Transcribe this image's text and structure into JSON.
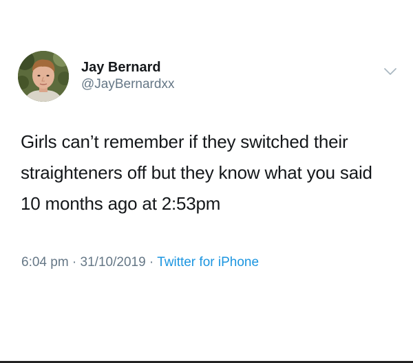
{
  "user": {
    "display_name": "Jay Bernard",
    "handle": "@JayBernardxx",
    "avatar_icon": "profile-photo"
  },
  "tweet": {
    "text": "Girls can’t remember if they switched their straighteners off but they know what you said 10 months ago at 2:53pm"
  },
  "meta": {
    "time": "6:04 pm",
    "separator": " · ",
    "date": "31/10/2019",
    "source": "Twitter for iPhone"
  },
  "colors": {
    "text_primary": "#14171a",
    "text_secondary": "#657786",
    "link": "#1b95e0",
    "background": "#ffffff"
  },
  "icons": {
    "menu": "chevron-down-icon"
  }
}
